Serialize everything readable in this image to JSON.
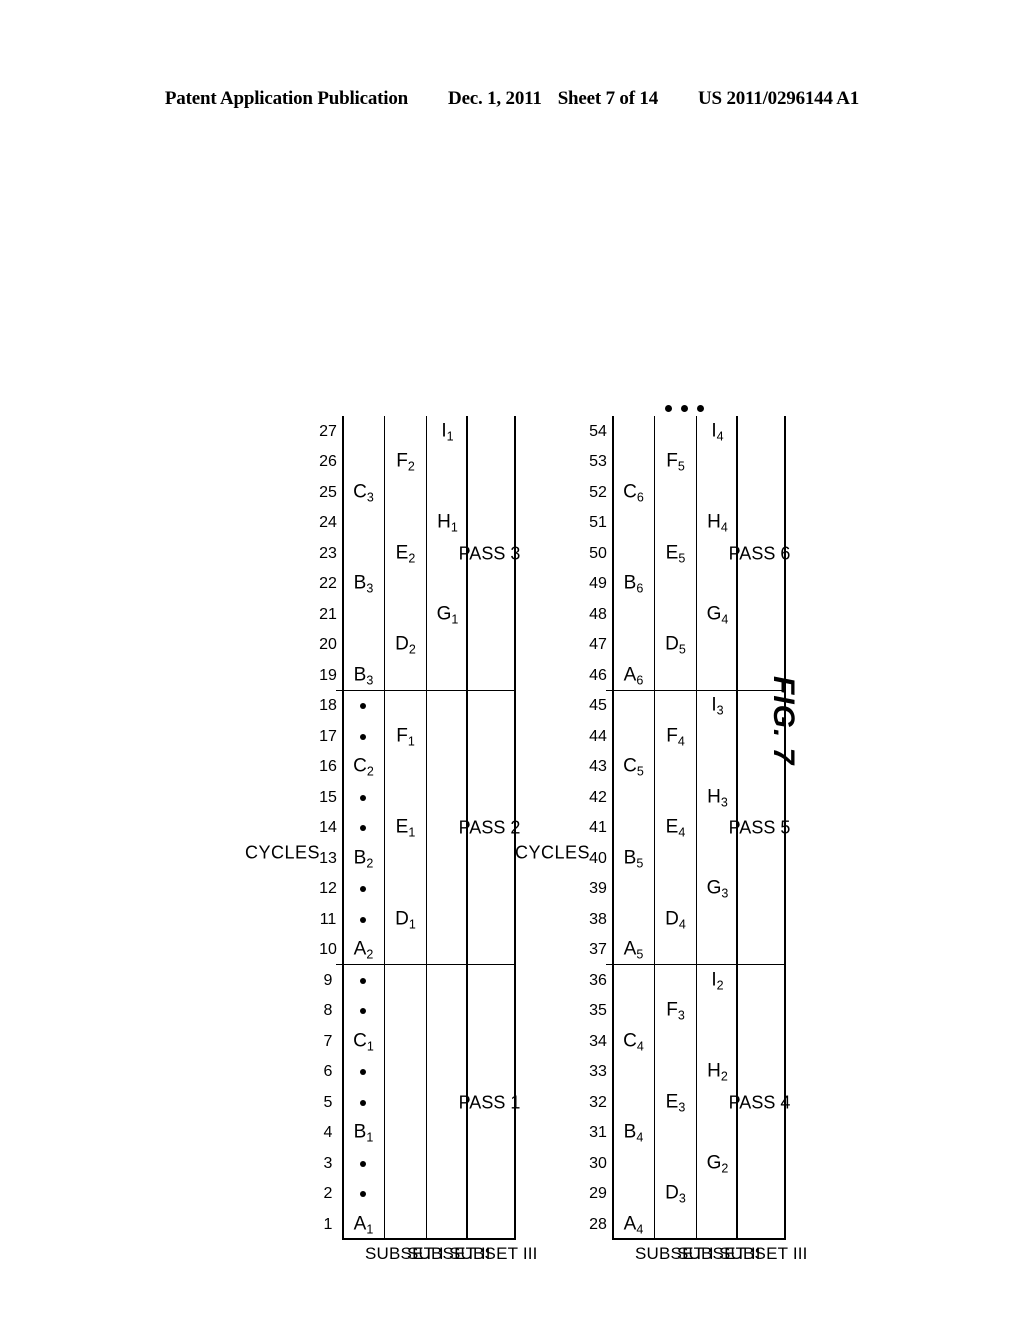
{
  "header": {
    "publication": "Patent Application Publication",
    "date": "Dec. 1, 2011",
    "sheet": "Sheet 7 of 14",
    "docnum": "US 2011/0296144 A1"
  },
  "figure": {
    "caption": "FIG. 7",
    "axis_title": "CYCLES",
    "subset_labels": [
      "SUBSET I",
      "SUBSET II",
      "SUBSET III"
    ],
    "ellipsis": "⋮"
  },
  "chart_data": {
    "type": "table",
    "title": "FIG. 7",
    "xlabel": "CYCLES",
    "ylabel": "",
    "row_labels": [
      "SUBSET I",
      "SUBSET II",
      "SUBSET III"
    ],
    "charts": [
      {
        "name": "top-chart",
        "cycle_start": 1,
        "cycle_end": 27,
        "cycles": [
          1,
          2,
          3,
          4,
          5,
          6,
          7,
          8,
          9,
          10,
          11,
          12,
          13,
          14,
          15,
          16,
          17,
          18,
          19,
          20,
          21,
          22,
          23,
          24,
          25,
          26,
          27
        ],
        "passes": [
          {
            "label": "PASS 1",
            "cycle_start": 1,
            "cycle_end": 9
          },
          {
            "label": "PASS 2",
            "cycle_start": 10,
            "cycle_end": 18
          },
          {
            "label": "PASS 3",
            "cycle_start": 19,
            "cycle_end": 27
          }
        ],
        "rows": [
          {
            "label": "SUBSET I",
            "entries": [
              {
                "cycle": 1,
                "text": "A",
                "sub": "1"
              },
              {
                "cycle": 2,
                "text": "•"
              },
              {
                "cycle": 3,
                "text": "•"
              },
              {
                "cycle": 4,
                "text": "B",
                "sub": "1"
              },
              {
                "cycle": 5,
                "text": "•"
              },
              {
                "cycle": 6,
                "text": "•"
              },
              {
                "cycle": 7,
                "text": "C",
                "sub": "1"
              },
              {
                "cycle": 8,
                "text": "•"
              },
              {
                "cycle": 9,
                "text": "•"
              },
              {
                "cycle": 10,
                "text": "A",
                "sub": "2"
              },
              {
                "cycle": 11,
                "text": "•"
              },
              {
                "cycle": 12,
                "text": "•"
              },
              {
                "cycle": 13,
                "text": "B",
                "sub": "2"
              },
              {
                "cycle": 14,
                "text": "•"
              },
              {
                "cycle": 15,
                "text": "•"
              },
              {
                "cycle": 16,
                "text": "C",
                "sub": "2"
              },
              {
                "cycle": 17,
                "text": "•"
              },
              {
                "cycle": 18,
                "text": "•"
              },
              {
                "cycle": 19,
                "text": "B",
                "sub": "3"
              },
              {
                "cycle": 22,
                "text": "B",
                "sub": "3"
              },
              {
                "cycle": 25,
                "text": "C",
                "sub": "3"
              }
            ]
          },
          {
            "label": "SUBSET II",
            "entries": [
              {
                "cycle": 11,
                "text": "D",
                "sub": "1"
              },
              {
                "cycle": 14,
                "text": "E",
                "sub": "1"
              },
              {
                "cycle": 17,
                "text": "F",
                "sub": "1"
              },
              {
                "cycle": 20,
                "text": "D",
                "sub": "2"
              },
              {
                "cycle": 23,
                "text": "E",
                "sub": "2"
              },
              {
                "cycle": 26,
                "text": "F",
                "sub": "2"
              }
            ]
          },
          {
            "label": "SUBSET III",
            "entries": [
              {
                "cycle": 21,
                "text": "G",
                "sub": "1"
              },
              {
                "cycle": 24,
                "text": "H",
                "sub": "1"
              },
              {
                "cycle": 27,
                "text": "I",
                "sub": "1"
              }
            ]
          }
        ]
      },
      {
        "name": "bottom-chart",
        "cycle_start": 28,
        "cycle_end": 54,
        "cycles": [
          28,
          29,
          30,
          31,
          32,
          33,
          34,
          35,
          36,
          37,
          38,
          39,
          40,
          41,
          42,
          43,
          44,
          45,
          46,
          47,
          48,
          49,
          50,
          51,
          52,
          53,
          54
        ],
        "passes": [
          {
            "label": "PASS 4",
            "cycle_start": 28,
            "cycle_end": 36
          },
          {
            "label": "PASS 5",
            "cycle_start": 37,
            "cycle_end": 45
          },
          {
            "label": "PASS 6",
            "cycle_start": 46,
            "cycle_end": 54
          }
        ],
        "rows": [
          {
            "label": "SUBSET I",
            "entries": [
              {
                "cycle": 28,
                "text": "A",
                "sub": "4"
              },
              {
                "cycle": 31,
                "text": "B",
                "sub": "4"
              },
              {
                "cycle": 34,
                "text": "C",
                "sub": "4"
              },
              {
                "cycle": 37,
                "text": "A",
                "sub": "5"
              },
              {
                "cycle": 40,
                "text": "B",
                "sub": "5"
              },
              {
                "cycle": 43,
                "text": "C",
                "sub": "5"
              },
              {
                "cycle": 46,
                "text": "A",
                "sub": "6"
              },
              {
                "cycle": 49,
                "text": "B",
                "sub": "6"
              },
              {
                "cycle": 52,
                "text": "C",
                "sub": "6"
              }
            ]
          },
          {
            "label": "SUBSET II",
            "entries": [
              {
                "cycle": 29,
                "text": "D",
                "sub": "3"
              },
              {
                "cycle": 32,
                "text": "E",
                "sub": "3"
              },
              {
                "cycle": 35,
                "text": "F",
                "sub": "3"
              },
              {
                "cycle": 38,
                "text": "D",
                "sub": "4"
              },
              {
                "cycle": 41,
                "text": "E",
                "sub": "4"
              },
              {
                "cycle": 44,
                "text": "F",
                "sub": "4"
              },
              {
                "cycle": 47,
                "text": "D",
                "sub": "5"
              },
              {
                "cycle": 50,
                "text": "E",
                "sub": "5"
              },
              {
                "cycle": 53,
                "text": "F",
                "sub": "5"
              }
            ]
          },
          {
            "label": "SUBSET III",
            "entries": [
              {
                "cycle": 30,
                "text": "G",
                "sub": "2"
              },
              {
                "cycle": 33,
                "text": "H",
                "sub": "2"
              },
              {
                "cycle": 36,
                "text": "I",
                "sub": "2"
              },
              {
                "cycle": 39,
                "text": "G",
                "sub": "3"
              },
              {
                "cycle": 42,
                "text": "H",
                "sub": "3"
              },
              {
                "cycle": 45,
                "text": "I",
                "sub": "3"
              },
              {
                "cycle": 48,
                "text": "G",
                "sub": "4"
              },
              {
                "cycle": 51,
                "text": "H",
                "sub": "4"
              },
              {
                "cycle": 54,
                "text": "I",
                "sub": "4"
              }
            ]
          }
        ]
      }
    ]
  }
}
